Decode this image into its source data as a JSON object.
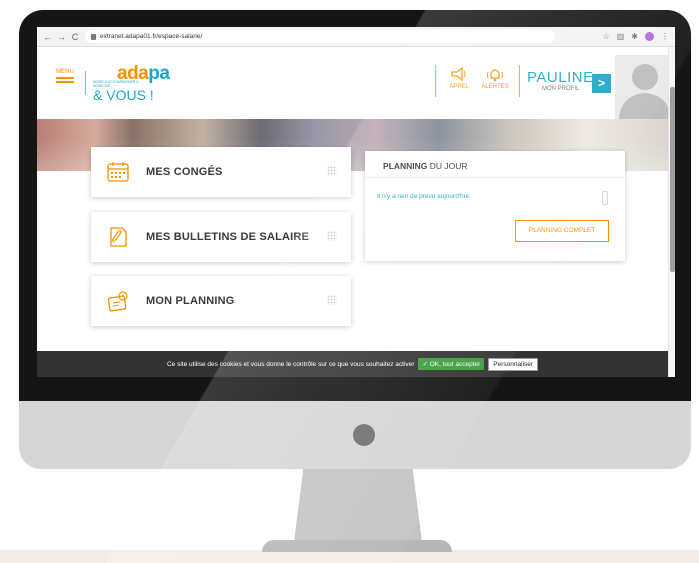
{
  "browser": {
    "url": "extranet.adapa01.fr/espace-salarie/",
    "nav_icons": [
      "back-icon",
      "forward-icon",
      "reload-icon"
    ],
    "toolbar_icons": [
      "star-icon",
      "extension-icon",
      "puzzle-icon",
      "profile-icon"
    ]
  },
  "header": {
    "menu_label": "MENU",
    "logo_word_a": "ada",
    "logo_word_b": "pa",
    "logo_tagline": "AIDER & ACCOMPAGNER À DOMICILE",
    "logo_vous": "& VOUS !",
    "call_label": "APPEL",
    "alerts_label": "ALERTES",
    "profile_name": "PAULINE",
    "profile_sub": "MON PROFIL",
    "profile_arrow": ">"
  },
  "tiles": [
    {
      "label": "MES CONGÉS",
      "icon": "calendar-icon"
    },
    {
      "label": "MES BULLETINS DE SALAIRE",
      "icon": "document-paperclip-icon"
    },
    {
      "label": "MON PLANNING",
      "icon": "planning-icon"
    }
  ],
  "planning": {
    "title_strong": "PLANNING",
    "title_rest": " DU JOUR",
    "empty_message": "Il n'y a rien de prévu aujourd'hui.",
    "button_label": "PLANNING COMPLET"
  },
  "cookie": {
    "message": "Ce site utilise des cookies et vous donne le contrôle sur ce que vous souhaitez activer",
    "accept_label": "✓ OK, tout accepter",
    "customize_label": "Personnaliser"
  },
  "colors": {
    "accent_orange": "#f39200",
    "accent_blue": "#1ba8c8",
    "cookie_bar": "#333333",
    "accept_green": "#3c9d3c"
  }
}
